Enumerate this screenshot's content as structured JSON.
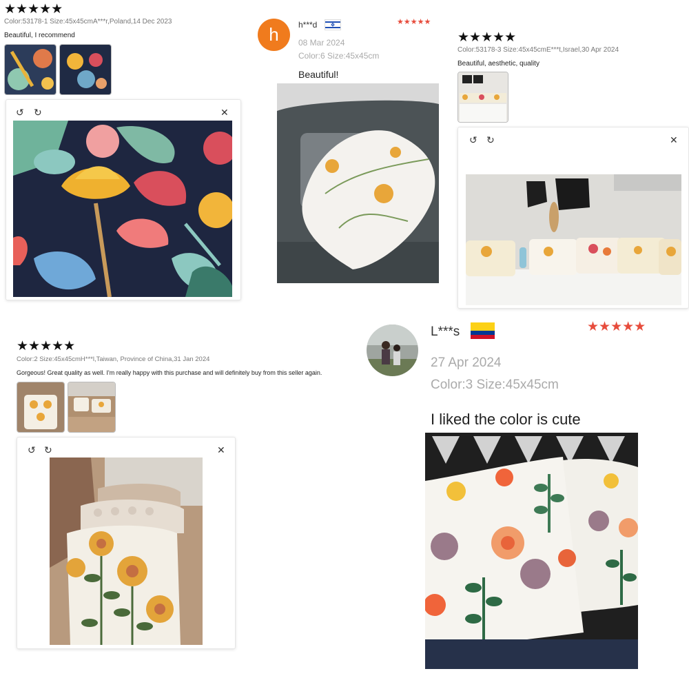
{
  "reviews": [
    {
      "stars": "★★★★★",
      "meta": "Color:53178-1 Size:45x45cmA***r,Poland,14 Dec 2023",
      "text": "Beautiful, I recommend"
    },
    {
      "avatar_letter": "h",
      "user": "h***d",
      "stars": "★★★★★",
      "date": "08 Mar 2024",
      "spec": "Color:6 Size:45x45cm",
      "text": "Beautiful!"
    },
    {
      "stars": "★★★★★",
      "meta": "Color:53178-3 Size:45x45cmE***t,Israel,30 Apr 2024",
      "text": "Beautiful, aesthetic, quality"
    },
    {
      "stars": "★★★★★",
      "meta": "Color:2 Size:45x45cmH***l,Taiwan, Province of China,31 Jan 2024",
      "text": "Gorgeous! Great quality as well. I'm really happy with this purchase and will definitely buy from this seller again."
    },
    {
      "user": "L***s",
      "stars": "★★★★★",
      "date": "27 Apr 2024",
      "spec": "Color:3 Size:45x45cm",
      "text": "I liked the color is cute"
    }
  ],
  "viewer_icons": {
    "rotate_left": "↺",
    "rotate_right": "↻",
    "close": "✕"
  },
  "colors": {
    "accent_avatar": "#f07b1d",
    "star_red": "#e74c3c",
    "star_black": "#111111"
  }
}
